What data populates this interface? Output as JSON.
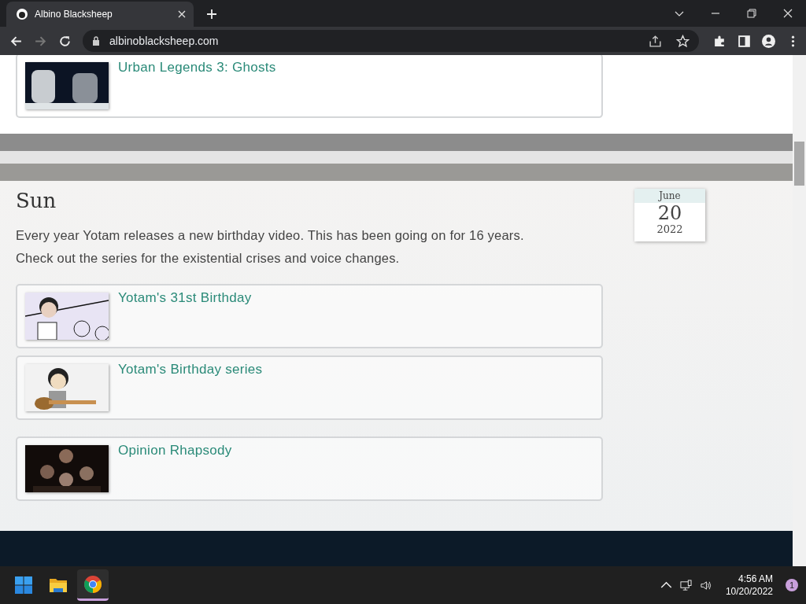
{
  "browser": {
    "tabs": [
      {
        "title": "Albino Blacksheep",
        "selected": true
      }
    ],
    "url": "albinoblacksheep.com"
  },
  "page": {
    "top_video": {
      "title": "Urban Legends 3: Ghosts"
    },
    "section": {
      "heading": "Sun",
      "date": {
        "month": "June",
        "day": "20",
        "year": "2022"
      },
      "description": [
        "Every year Yotam releases a new birthday video. This has been going on for 16 years.",
        "Check out the series for the existential crises and voice changes."
      ],
      "videos": [
        {
          "title": "Yotam's 31st Birthday"
        },
        {
          "title": "Yotam's Birthday series"
        },
        {
          "title": "Opinion Rhapsody"
        }
      ]
    }
  },
  "taskbar": {
    "apps": [
      {
        "kind": "start",
        "selected": false
      },
      {
        "kind": "files",
        "selected": false
      },
      {
        "kind": "browser",
        "selected": true
      }
    ],
    "time": "4:56 AM",
    "date": "10/20/2022",
    "notifications": "1"
  }
}
